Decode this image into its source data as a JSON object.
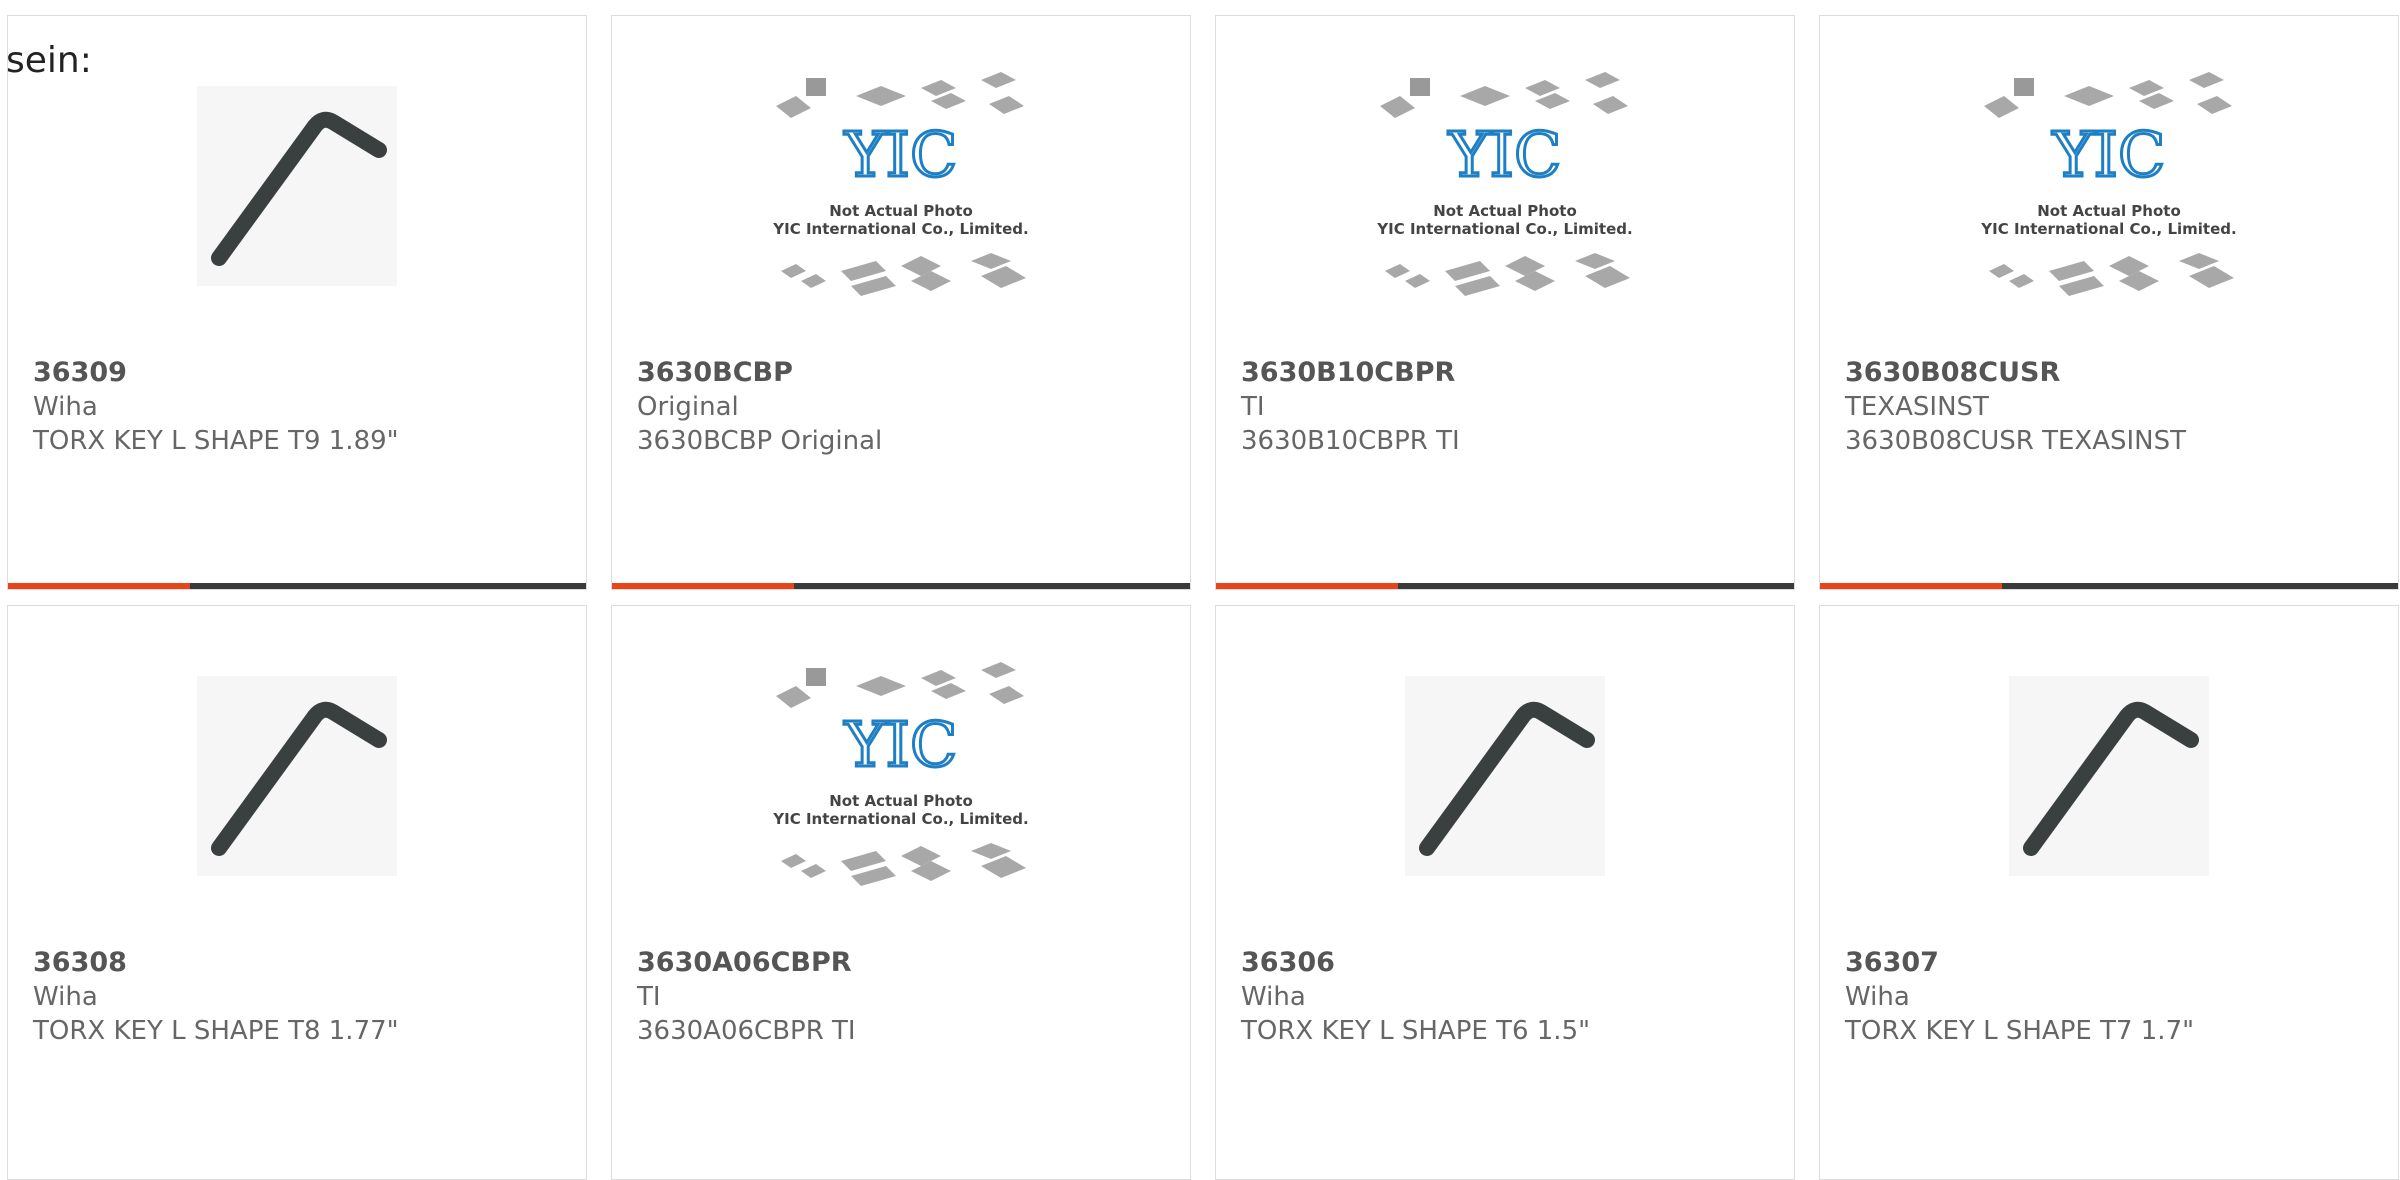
{
  "intro_text": "sein:",
  "colors": {
    "accent": "#e8441a",
    "bar": "#3a3a3a",
    "border": "#dcdcdc",
    "yic_blue": "#1e7fc4"
  },
  "placeholder": {
    "line1": "Not Actual Photo",
    "line2": "YIC International Co., Limited.",
    "logo": "YIC"
  },
  "products": [
    {
      "part": "36309",
      "brand": "Wiha",
      "desc": "TORX KEY L SHAPE T9 1.89\"",
      "image": "allen-key-icon"
    },
    {
      "part": "3630BCBP",
      "brand": "Original",
      "desc": "3630BCBP Original",
      "image": "yic-placeholder"
    },
    {
      "part": "3630B10CBPR",
      "brand": "TI",
      "desc": "3630B10CBPR TI",
      "image": "yic-placeholder"
    },
    {
      "part": "3630B08CUSR",
      "brand": "TEXASINST",
      "desc": "3630B08CUSR TEXASINST",
      "image": "yic-placeholder"
    },
    {
      "part": "36308",
      "brand": "Wiha",
      "desc": "TORX KEY L SHAPE T8 1.77\"",
      "image": "allen-key-icon"
    },
    {
      "part": "3630A06CBPR",
      "brand": "TI",
      "desc": "3630A06CBPR TI",
      "image": "yic-placeholder"
    },
    {
      "part": "36306",
      "brand": "Wiha",
      "desc": "TORX KEY L SHAPE T6 1.5\"",
      "image": "allen-key-icon"
    },
    {
      "part": "36307",
      "brand": "Wiha",
      "desc": "TORX KEY L SHAPE T7 1.7\"",
      "image": "allen-key-icon"
    }
  ]
}
